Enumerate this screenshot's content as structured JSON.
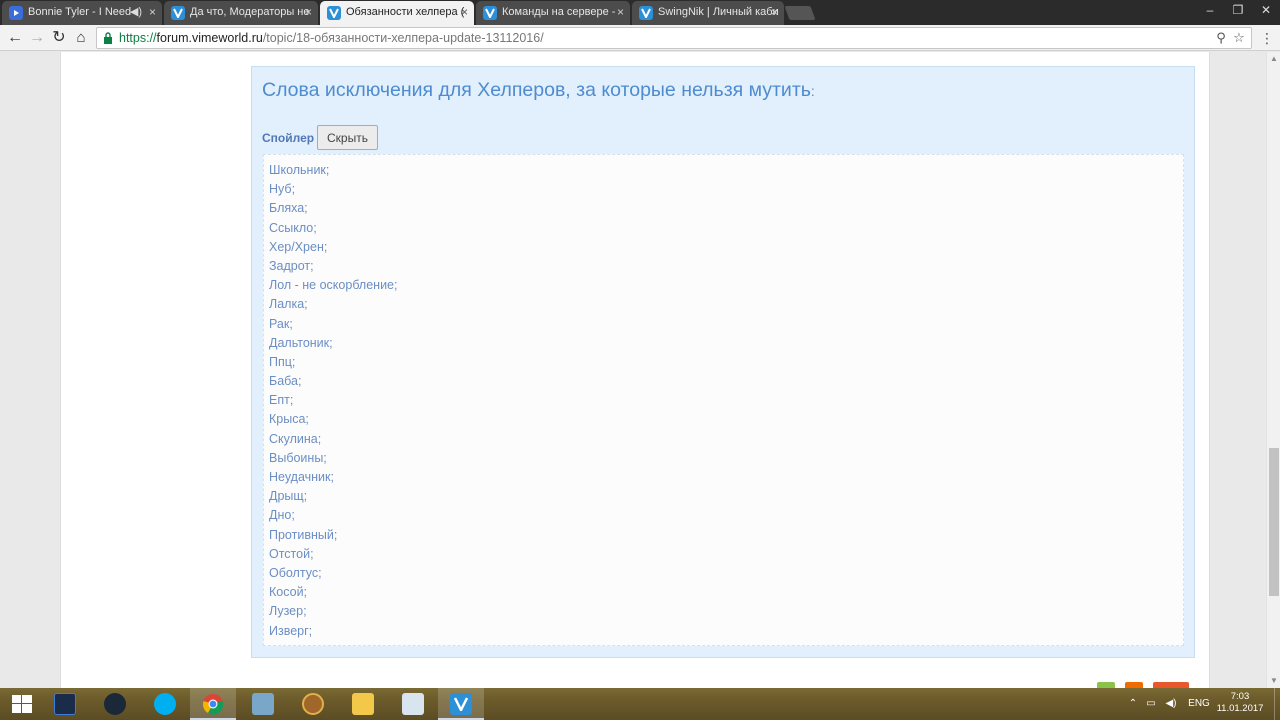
{
  "browser": {
    "tabs": [
      {
        "title": "Bonnie Tyler - I Need",
        "favicon": "youtube-icon",
        "audio": true
      },
      {
        "title": "Да что, Модераторы не",
        "favicon": "vimeworld-icon"
      },
      {
        "title": "Обязанности хелпера (",
        "favicon": "vimeworld-icon",
        "active": true
      },
      {
        "title": "Команды на сервере - ",
        "favicon": "vimeworld-icon"
      },
      {
        "title": "SwingNik | Личный каби",
        "favicon": "vimeworld-icon"
      }
    ],
    "url": {
      "scheme": "https://",
      "host": "forum.vimeworld.ru",
      "path": "/topic/18-обязанности-хелпера-update-13112016/"
    }
  },
  "post": {
    "title": "Слова исключения для Хелперов, за которые нельзя мутить",
    "title_colon": ":",
    "spoiler_label": "Спойлер",
    "spoiler_button": "Скрыть",
    "words": [
      "Школьник;",
      "Нуб;",
      "Бляха;",
      "Ссыкло;",
      "Хер/Хрен;",
      "Задрот;",
      "Лол - не оскорбление;",
      "Лалка;",
      "Рак;",
      "Дальтоник;",
      "Ппц;",
      "Баба;",
      "Епт;",
      "Крыса;",
      "Скулина;",
      "Выбоины;",
      "Неудачник;",
      "Дрыщ;",
      "Дно;",
      "Противный;",
      "Отстой;",
      "Оболтус;",
      "Косой;",
      "Лузер;",
      "Изверг;"
    ]
  },
  "taskbar": {
    "apps": [
      "windows-start-icon",
      "battlenet-icon",
      "steam-icon",
      "skype-icon",
      "chrome-icon",
      "control-panel-icon",
      "hearthstone-icon",
      "file-explorer-icon",
      "paint-icon",
      "vimeworld-icon"
    ],
    "language": "ENG",
    "time": "7:03",
    "date": "11.01.2017"
  },
  "colors": {
    "accent_blue": "#4e8bd0",
    "spoiler_bg": "#e1f0fc",
    "word_text": "#6b8ec4"
  }
}
